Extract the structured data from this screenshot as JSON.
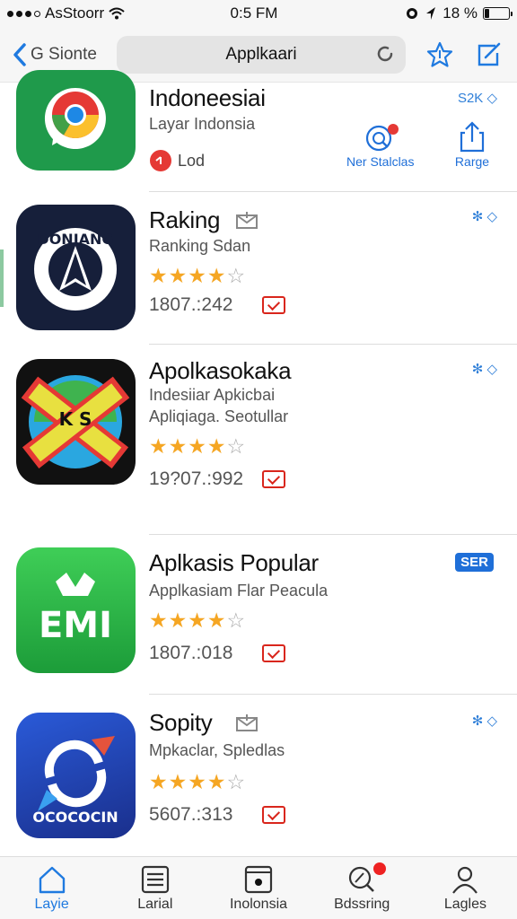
{
  "status_bar": {
    "carrier": "AsStoorr",
    "time": "0:5 FM",
    "battery": "18 %",
    "battery_level": 0.18
  },
  "nav": {
    "back_label": "G Sionte",
    "search_text": "Applkaari"
  },
  "apps": [
    {
      "title": "Indoneesiai",
      "subtitle": "Layar  Indonsia",
      "extra": "Lod",
      "corner": "S2K ◇",
      "actions": [
        {
          "label": "Ner Stalclas"
        },
        {
          "label": "Rarge"
        }
      ]
    },
    {
      "title": "Raking",
      "subtitle": "Ranking Sdan",
      "rating": 3.5,
      "count": "1807.:242",
      "corner": "✻ ◇",
      "icon_text": "DONIANG"
    },
    {
      "title": "Apolkasokaka",
      "subtitle": "Indesiiar Apkicbai",
      "subtitle2": "Apliqiaga. Seotullar",
      "rating": 4,
      "count": "19?07.:992",
      "corner": "✻ ◇",
      "icon_text": "K S"
    },
    {
      "title": "Aplkasis Popular",
      "subtitle": "Applkasiam Flar Peacula",
      "rating": 4,
      "count": "1807.:018",
      "badge": "SER",
      "icon_text": "EMI"
    },
    {
      "title": "Sopity",
      "subtitle": "Mpkaclar, Spledlas",
      "rating": 4,
      "count": "5607.:313",
      "corner": "✻ ◇",
      "icon_text": "OCOCOCIN"
    }
  ],
  "tabs": [
    {
      "label": "Layie"
    },
    {
      "label": "Larial"
    },
    {
      "label": "Inolonsia"
    },
    {
      "label": "Bdssring"
    },
    {
      "label": "Lagles"
    }
  ],
  "colors": {
    "accent": "#1f7ae0",
    "star": "#f5a623",
    "badge_red": "#d9261c"
  }
}
